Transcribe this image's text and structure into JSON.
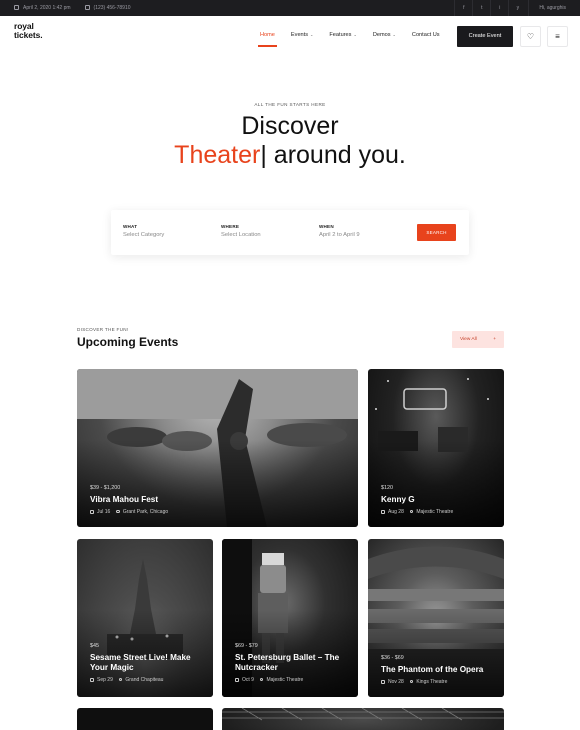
{
  "topbar": {
    "datetime": "April 2, 2020 1:42 pm",
    "phone": "(123) 456-78910",
    "social": [
      "f",
      "t",
      "i",
      "y"
    ],
    "user": "Hi, agurghis"
  },
  "header": {
    "logo_line1": "royal",
    "logo_line2": "tickets.",
    "nav": [
      {
        "label": "Home"
      },
      {
        "label": "Events",
        "chevron": "⌄"
      },
      {
        "label": "Features",
        "chevron": "⌄"
      },
      {
        "label": "Demos",
        "chevron": "⌄"
      },
      {
        "label": "Contact Us"
      }
    ],
    "create_label": "Create Event",
    "heart_icon": "♡",
    "menu_icon": "≡"
  },
  "hero": {
    "kicker": "ALL THE FUN STARTS HERE",
    "line1": "Discover",
    "accent": "Theater",
    "line2_rest": "| around you."
  },
  "search": {
    "what_label": "WHAT",
    "what_placeholder": "Select Category",
    "where_label": "WHERE",
    "where_placeholder": "Select Location",
    "when_label": "WHEN",
    "when_value": "April 2 to April 9",
    "button_label": "SEARCH"
  },
  "section": {
    "kicker": "DISCOVER THE FUN!",
    "title": "Upcoming Events",
    "view_all": "View All",
    "view_all_icon": "+"
  },
  "events": [
    {
      "price": "$39 - $1,200",
      "title": "Vibra Mahou Fest",
      "date": "Jul 16",
      "place": "Grant Park, Chicago"
    },
    {
      "price": "$120",
      "title": "Kenny G",
      "date": "Aug 28",
      "place": "Majestic Theatre"
    },
    {
      "price": "$45",
      "title": "Sesame Street Live! Make Your Magic",
      "date": "Sep 29",
      "place": "Grand Chapiteau"
    },
    {
      "price": "$69 - $79",
      "title": "St. Petersburg Ballet – The Nutcracker",
      "date": "Oct 9",
      "place": "Majestic Theatre"
    },
    {
      "price": "$36 - $69",
      "title": "The Phantom of the Opera",
      "date": "Nov 28",
      "place": "Kings Theatre"
    }
  ]
}
